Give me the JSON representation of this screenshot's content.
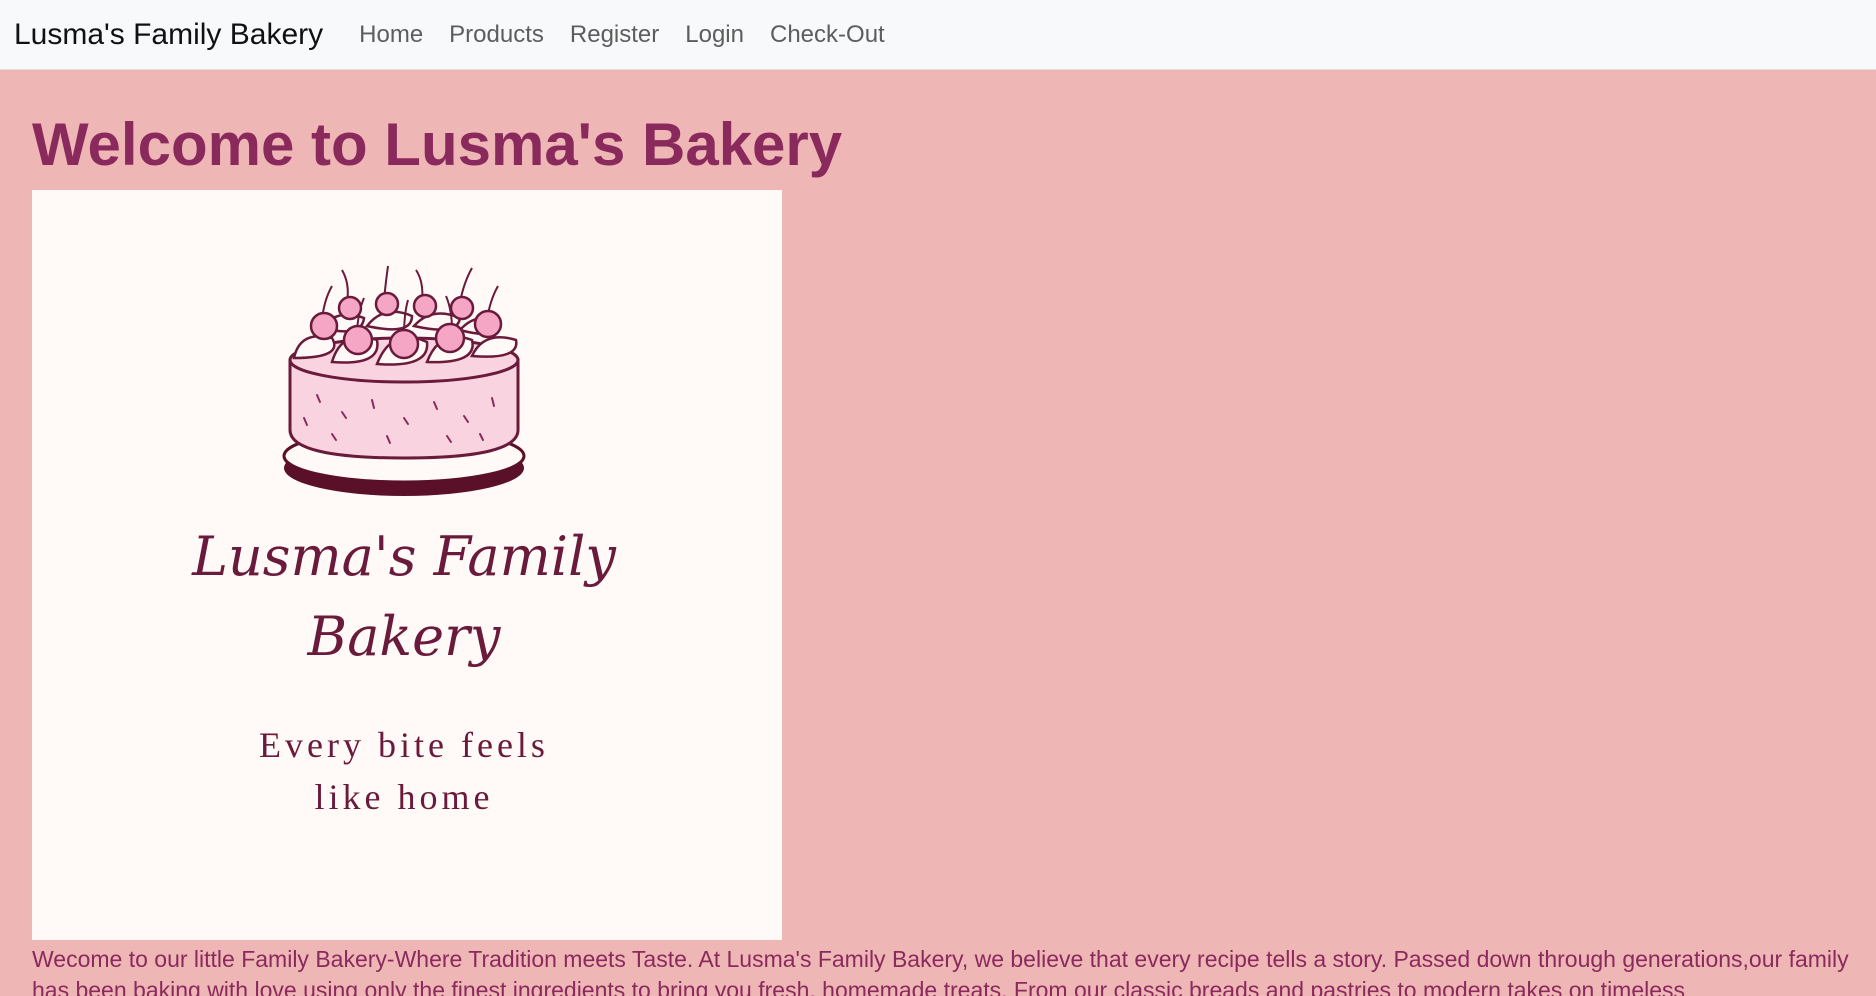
{
  "navbar": {
    "brand": "Lusma's Family Bakery",
    "links": [
      "Home",
      "Products",
      "Register",
      "Login",
      "Check-Out"
    ]
  },
  "main": {
    "title": "Welcome to Lusma's Bakery",
    "logo": {
      "name_line1": "Lusma's Family",
      "name_line2": "Bakery",
      "tagline_line1": "Every bite feels",
      "tagline_line2": "like home",
      "icon": "cake-icon"
    },
    "intro": "Wecome to our little Family Bakery-Where Tradition meets Taste. At Lusma's Family Bakery, we believe that every recipe tells a story. Passed down through generations,our family has been baking with love using only the finest ingredients to bring you fresh, homemade treats. From our classic breads and pastries to modern takes on timeless"
  },
  "colors": {
    "page_background": "#efb6b6",
    "navbar_background": "#f8f9fa",
    "accent": "#8a2a5c",
    "logo_background": "#fffaf7",
    "cake_pink": "#f4a6c4",
    "plate_dark": "#5a1028"
  }
}
